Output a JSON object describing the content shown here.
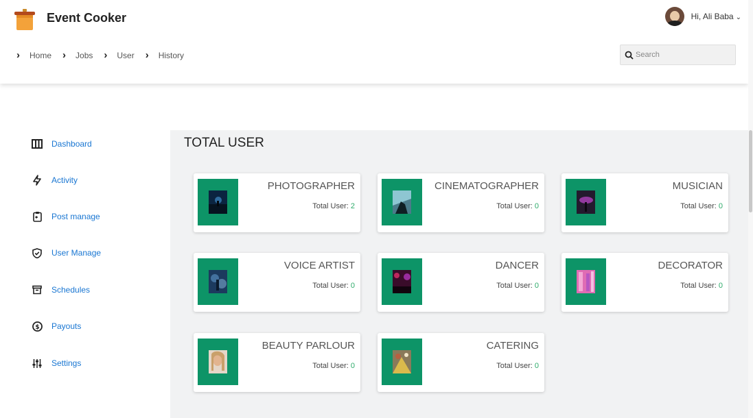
{
  "app": {
    "title": "Event Cooker"
  },
  "user": {
    "greeting": "Hi, Ali Baba",
    "caret": "⌄"
  },
  "breadcrumb": [
    {
      "label": "Home"
    },
    {
      "label": "Jobs"
    },
    {
      "label": "User"
    },
    {
      "label": "History"
    }
  ],
  "search": {
    "placeholder": "Search"
  },
  "sidebar": {
    "items": [
      {
        "label": "Dashboard",
        "icon": "columns-icon"
      },
      {
        "label": "Activity",
        "icon": "lightning-icon"
      },
      {
        "label": "Post manage",
        "icon": "clipboard-icon"
      },
      {
        "label": "User Manage",
        "icon": "shield-check-icon"
      },
      {
        "label": "Schedules",
        "icon": "archive-box-icon"
      },
      {
        "label": "Payouts",
        "icon": "dollar-circle-icon"
      },
      {
        "label": "Settings",
        "icon": "sliders-icon"
      }
    ]
  },
  "main": {
    "title": "TOTAL USER",
    "count_label": "Total User: ",
    "cards": [
      {
        "name": "PHOTOGRAPHER",
        "count": "2"
      },
      {
        "name": "CINEMATOGRAPHER",
        "count": "0"
      },
      {
        "name": "MUSICIAN",
        "count": "0"
      },
      {
        "name": "VOICE ARTIST",
        "count": "0"
      },
      {
        "name": "DANCER",
        "count": "0"
      },
      {
        "name": "DECORATOR",
        "count": "0"
      },
      {
        "name": "BEAUTY PARLOUR",
        "count": "0"
      },
      {
        "name": "CATERING",
        "count": "0"
      }
    ]
  },
  "colors": {
    "accent": "#0d9467",
    "link": "#1976d2",
    "count": "#2eab6a"
  }
}
